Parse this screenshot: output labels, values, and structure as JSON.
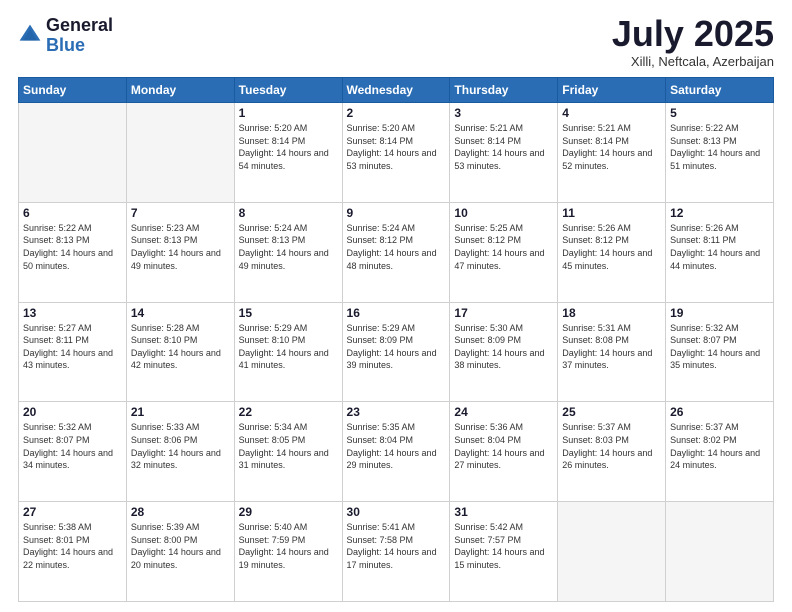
{
  "logo": {
    "general": "General",
    "blue": "Blue"
  },
  "header": {
    "month": "July 2025",
    "location": "Xilli, Neftcala, Azerbaijan"
  },
  "days_of_week": [
    "Sunday",
    "Monday",
    "Tuesday",
    "Wednesday",
    "Thursday",
    "Friday",
    "Saturday"
  ],
  "weeks": [
    [
      {
        "day": "",
        "info": ""
      },
      {
        "day": "",
        "info": ""
      },
      {
        "day": "1",
        "info": "Sunrise: 5:20 AM\nSunset: 8:14 PM\nDaylight: 14 hours and 54 minutes."
      },
      {
        "day": "2",
        "info": "Sunrise: 5:20 AM\nSunset: 8:14 PM\nDaylight: 14 hours and 53 minutes."
      },
      {
        "day": "3",
        "info": "Sunrise: 5:21 AM\nSunset: 8:14 PM\nDaylight: 14 hours and 53 minutes."
      },
      {
        "day": "4",
        "info": "Sunrise: 5:21 AM\nSunset: 8:14 PM\nDaylight: 14 hours and 52 minutes."
      },
      {
        "day": "5",
        "info": "Sunrise: 5:22 AM\nSunset: 8:13 PM\nDaylight: 14 hours and 51 minutes."
      }
    ],
    [
      {
        "day": "6",
        "info": "Sunrise: 5:22 AM\nSunset: 8:13 PM\nDaylight: 14 hours and 50 minutes."
      },
      {
        "day": "7",
        "info": "Sunrise: 5:23 AM\nSunset: 8:13 PM\nDaylight: 14 hours and 49 minutes."
      },
      {
        "day": "8",
        "info": "Sunrise: 5:24 AM\nSunset: 8:13 PM\nDaylight: 14 hours and 49 minutes."
      },
      {
        "day": "9",
        "info": "Sunrise: 5:24 AM\nSunset: 8:12 PM\nDaylight: 14 hours and 48 minutes."
      },
      {
        "day": "10",
        "info": "Sunrise: 5:25 AM\nSunset: 8:12 PM\nDaylight: 14 hours and 47 minutes."
      },
      {
        "day": "11",
        "info": "Sunrise: 5:26 AM\nSunset: 8:12 PM\nDaylight: 14 hours and 45 minutes."
      },
      {
        "day": "12",
        "info": "Sunrise: 5:26 AM\nSunset: 8:11 PM\nDaylight: 14 hours and 44 minutes."
      }
    ],
    [
      {
        "day": "13",
        "info": "Sunrise: 5:27 AM\nSunset: 8:11 PM\nDaylight: 14 hours and 43 minutes."
      },
      {
        "day": "14",
        "info": "Sunrise: 5:28 AM\nSunset: 8:10 PM\nDaylight: 14 hours and 42 minutes."
      },
      {
        "day": "15",
        "info": "Sunrise: 5:29 AM\nSunset: 8:10 PM\nDaylight: 14 hours and 41 minutes."
      },
      {
        "day": "16",
        "info": "Sunrise: 5:29 AM\nSunset: 8:09 PM\nDaylight: 14 hours and 39 minutes."
      },
      {
        "day": "17",
        "info": "Sunrise: 5:30 AM\nSunset: 8:09 PM\nDaylight: 14 hours and 38 minutes."
      },
      {
        "day": "18",
        "info": "Sunrise: 5:31 AM\nSunset: 8:08 PM\nDaylight: 14 hours and 37 minutes."
      },
      {
        "day": "19",
        "info": "Sunrise: 5:32 AM\nSunset: 8:07 PM\nDaylight: 14 hours and 35 minutes."
      }
    ],
    [
      {
        "day": "20",
        "info": "Sunrise: 5:32 AM\nSunset: 8:07 PM\nDaylight: 14 hours and 34 minutes."
      },
      {
        "day": "21",
        "info": "Sunrise: 5:33 AM\nSunset: 8:06 PM\nDaylight: 14 hours and 32 minutes."
      },
      {
        "day": "22",
        "info": "Sunrise: 5:34 AM\nSunset: 8:05 PM\nDaylight: 14 hours and 31 minutes."
      },
      {
        "day": "23",
        "info": "Sunrise: 5:35 AM\nSunset: 8:04 PM\nDaylight: 14 hours and 29 minutes."
      },
      {
        "day": "24",
        "info": "Sunrise: 5:36 AM\nSunset: 8:04 PM\nDaylight: 14 hours and 27 minutes."
      },
      {
        "day": "25",
        "info": "Sunrise: 5:37 AM\nSunset: 8:03 PM\nDaylight: 14 hours and 26 minutes."
      },
      {
        "day": "26",
        "info": "Sunrise: 5:37 AM\nSunset: 8:02 PM\nDaylight: 14 hours and 24 minutes."
      }
    ],
    [
      {
        "day": "27",
        "info": "Sunrise: 5:38 AM\nSunset: 8:01 PM\nDaylight: 14 hours and 22 minutes."
      },
      {
        "day": "28",
        "info": "Sunrise: 5:39 AM\nSunset: 8:00 PM\nDaylight: 14 hours and 20 minutes."
      },
      {
        "day": "29",
        "info": "Sunrise: 5:40 AM\nSunset: 7:59 PM\nDaylight: 14 hours and 19 minutes."
      },
      {
        "day": "30",
        "info": "Sunrise: 5:41 AM\nSunset: 7:58 PM\nDaylight: 14 hours and 17 minutes."
      },
      {
        "day": "31",
        "info": "Sunrise: 5:42 AM\nSunset: 7:57 PM\nDaylight: 14 hours and 15 minutes."
      },
      {
        "day": "",
        "info": ""
      },
      {
        "day": "",
        "info": ""
      }
    ]
  ]
}
